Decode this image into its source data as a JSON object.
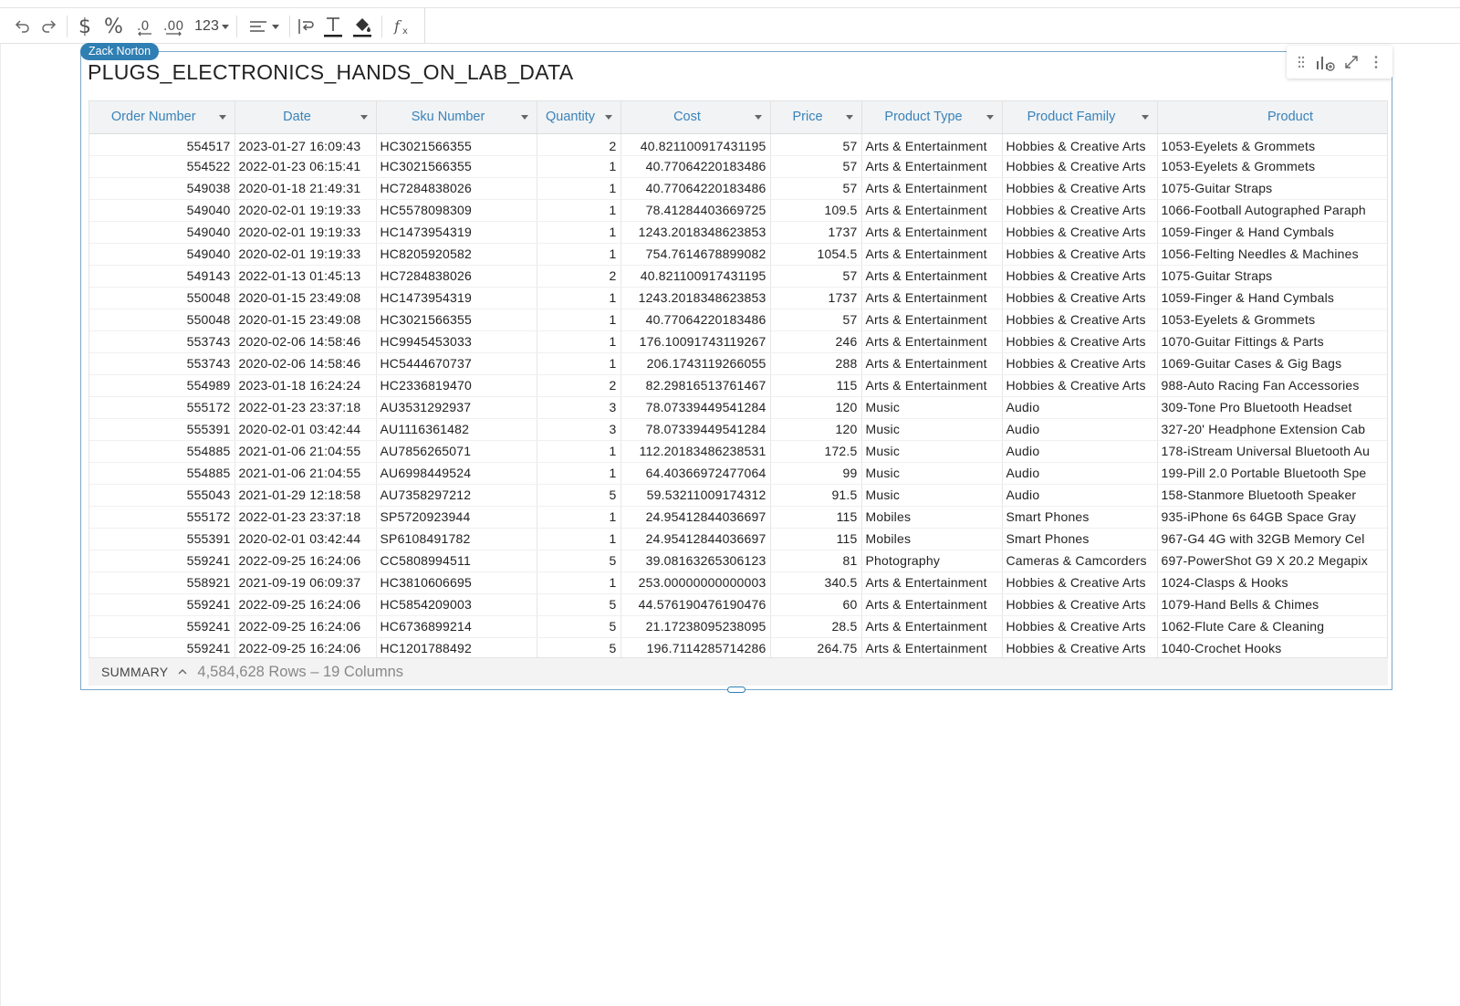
{
  "toolbar": {
    "number_format_label": "123"
  },
  "worksheet": {
    "user_tag": "Zack Norton",
    "title": "PLUGS_ELECTRONICS_HANDS_ON_LAB_DATA"
  },
  "table": {
    "columns": [
      {
        "label": "Order Number"
      },
      {
        "label": "Date"
      },
      {
        "label": "Sku Number"
      },
      {
        "label": "Quantity"
      },
      {
        "label": "Cost"
      },
      {
        "label": "Price"
      },
      {
        "label": "Product Type"
      },
      {
        "label": "Product Family"
      },
      {
        "label": "Product"
      }
    ],
    "rows": [
      [
        "554517",
        "2023-01-27 16:09:43",
        "HC3021566355",
        "2",
        "40.821100917431195",
        "57",
        "Arts & Entertainment",
        "Hobbies & Creative Arts",
        "1053-Eyelets & Grommets"
      ],
      [
        "554522",
        "2022-01-23 06:15:41",
        "HC3021566355",
        "1",
        "40.77064220183486",
        "57",
        "Arts & Entertainment",
        "Hobbies & Creative Arts",
        "1053-Eyelets & Grommets"
      ],
      [
        "549038",
        "2020-01-18 21:49:31",
        "HC7284838026",
        "1",
        "40.77064220183486",
        "57",
        "Arts & Entertainment",
        "Hobbies & Creative Arts",
        "1075-Guitar Straps"
      ],
      [
        "549040",
        "2020-02-01 19:19:33",
        "HC5578098309",
        "1",
        "78.41284403669725",
        "109.5",
        "Arts & Entertainment",
        "Hobbies & Creative Arts",
        "1066-Football Autographed Paraph"
      ],
      [
        "549040",
        "2020-02-01 19:19:33",
        "HC1473954319",
        "1",
        "1243.2018348623853",
        "1737",
        "Arts & Entertainment",
        "Hobbies & Creative Arts",
        "1059-Finger & Hand Cymbals"
      ],
      [
        "549040",
        "2020-02-01 19:19:33",
        "HC8205920582",
        "1",
        "754.7614678899082",
        "1054.5",
        "Arts & Entertainment",
        "Hobbies & Creative Arts",
        "1056-Felting Needles & Machines"
      ],
      [
        "549143",
        "2022-01-13 01:45:13",
        "HC7284838026",
        "2",
        "40.821100917431195",
        "57",
        "Arts & Entertainment",
        "Hobbies & Creative Arts",
        "1075-Guitar Straps"
      ],
      [
        "550048",
        "2020-01-15 23:49:08",
        "HC1473954319",
        "1",
        "1243.2018348623853",
        "1737",
        "Arts & Entertainment",
        "Hobbies & Creative Arts",
        "1059-Finger & Hand Cymbals"
      ],
      [
        "550048",
        "2020-01-15 23:49:08",
        "HC3021566355",
        "1",
        "40.77064220183486",
        "57",
        "Arts & Entertainment",
        "Hobbies & Creative Arts",
        "1053-Eyelets & Grommets"
      ],
      [
        "553743",
        "2020-02-06 14:58:46",
        "HC9945453033",
        "1",
        "176.10091743119267",
        "246",
        "Arts & Entertainment",
        "Hobbies & Creative Arts",
        "1070-Guitar Fittings & Parts"
      ],
      [
        "553743",
        "2020-02-06 14:58:46",
        "HC5444670737",
        "1",
        "206.1743119266055",
        "288",
        "Arts & Entertainment",
        "Hobbies & Creative Arts",
        "1069-Guitar Cases & Gig Bags"
      ],
      [
        "554989",
        "2023-01-18 16:24:24",
        "HC2336819470",
        "2",
        "82.29816513761467",
        "115",
        "Arts & Entertainment",
        "Hobbies & Creative Arts",
        "988-Auto Racing Fan Accessories"
      ],
      [
        "555172",
        "2022-01-23 23:37:18",
        "AU3531292937",
        "3",
        "78.07339449541284",
        "120",
        "Music",
        "Audio",
        "309-Tone Pro Bluetooth Headset"
      ],
      [
        "555391",
        "2020-02-01 03:42:44",
        "AU1116361482",
        "3",
        "78.07339449541284",
        "120",
        "Music",
        "Audio",
        "327-20' Headphone Extension Cab"
      ],
      [
        "554885",
        "2021-01-06 21:04:55",
        "AU7856265071",
        "1",
        "112.20183486238531",
        "172.5",
        "Music",
        "Audio",
        "178-iStream Universal Bluetooth Au"
      ],
      [
        "554885",
        "2021-01-06 21:04:55",
        "AU6998449524",
        "1",
        "64.40366972477064",
        "99",
        "Music",
        "Audio",
        "199-Pill 2.0 Portable Bluetooth Spe"
      ],
      [
        "555043",
        "2021-01-29 12:18:58",
        "AU7358297212",
        "5",
        "59.53211009174312",
        "91.5",
        "Music",
        "Audio",
        "158-Stanmore Bluetooth Speaker"
      ],
      [
        "555172",
        "2022-01-23 23:37:18",
        "SP5720923944",
        "1",
        "24.95412844036697",
        "115",
        "Mobiles",
        "Smart Phones",
        "935-iPhone 6s 64GB   Space Gray"
      ],
      [
        "555391",
        "2020-02-01 03:42:44",
        "SP6108491782",
        "1",
        "24.95412844036697",
        "115",
        "Mobiles",
        "Smart Phones",
        "967-G4 4G with 32GB Memory Cel"
      ],
      [
        "559241",
        "2022-09-25 16:24:06",
        "CC5808994511",
        "5",
        "39.08163265306123",
        "81",
        "Photography",
        "Cameras & Camcorders",
        "697-PowerShot G9 X 20.2 Megapix"
      ],
      [
        "558921",
        "2021-09-19 06:09:37",
        "HC3810606695",
        "1",
        "253.00000000000003",
        "340.5",
        "Arts & Entertainment",
        "Hobbies & Creative Arts",
        "1024-Clasps & Hooks"
      ],
      [
        "559241",
        "2022-09-25 16:24:06",
        "HC5854209003",
        "5",
        "44.576190476190476",
        "60",
        "Arts & Entertainment",
        "Hobbies & Creative Arts",
        "1079-Hand Bells & Chimes"
      ],
      [
        "559241",
        "2022-09-25 16:24:06",
        "HC6736899214",
        "5",
        "21.17238095238095",
        "28.5",
        "Arts & Entertainment",
        "Hobbies & Creative Arts",
        "1062-Flute Care & Cleaning"
      ],
      [
        "559241",
        "2022-09-25 16:24:06",
        "HC1201788492",
        "5",
        "196.7114285714286",
        "264.75",
        "Arts & Entertainment",
        "Hobbies & Creative Arts",
        "1040-Crochet Hooks"
      ]
    ]
  },
  "summary": {
    "label": "SUMMARY",
    "info": "4,584,628 Rows – 19 Columns"
  },
  "colors": {
    "accent": "#2f7fb3",
    "header_text": "#3a82b8"
  }
}
